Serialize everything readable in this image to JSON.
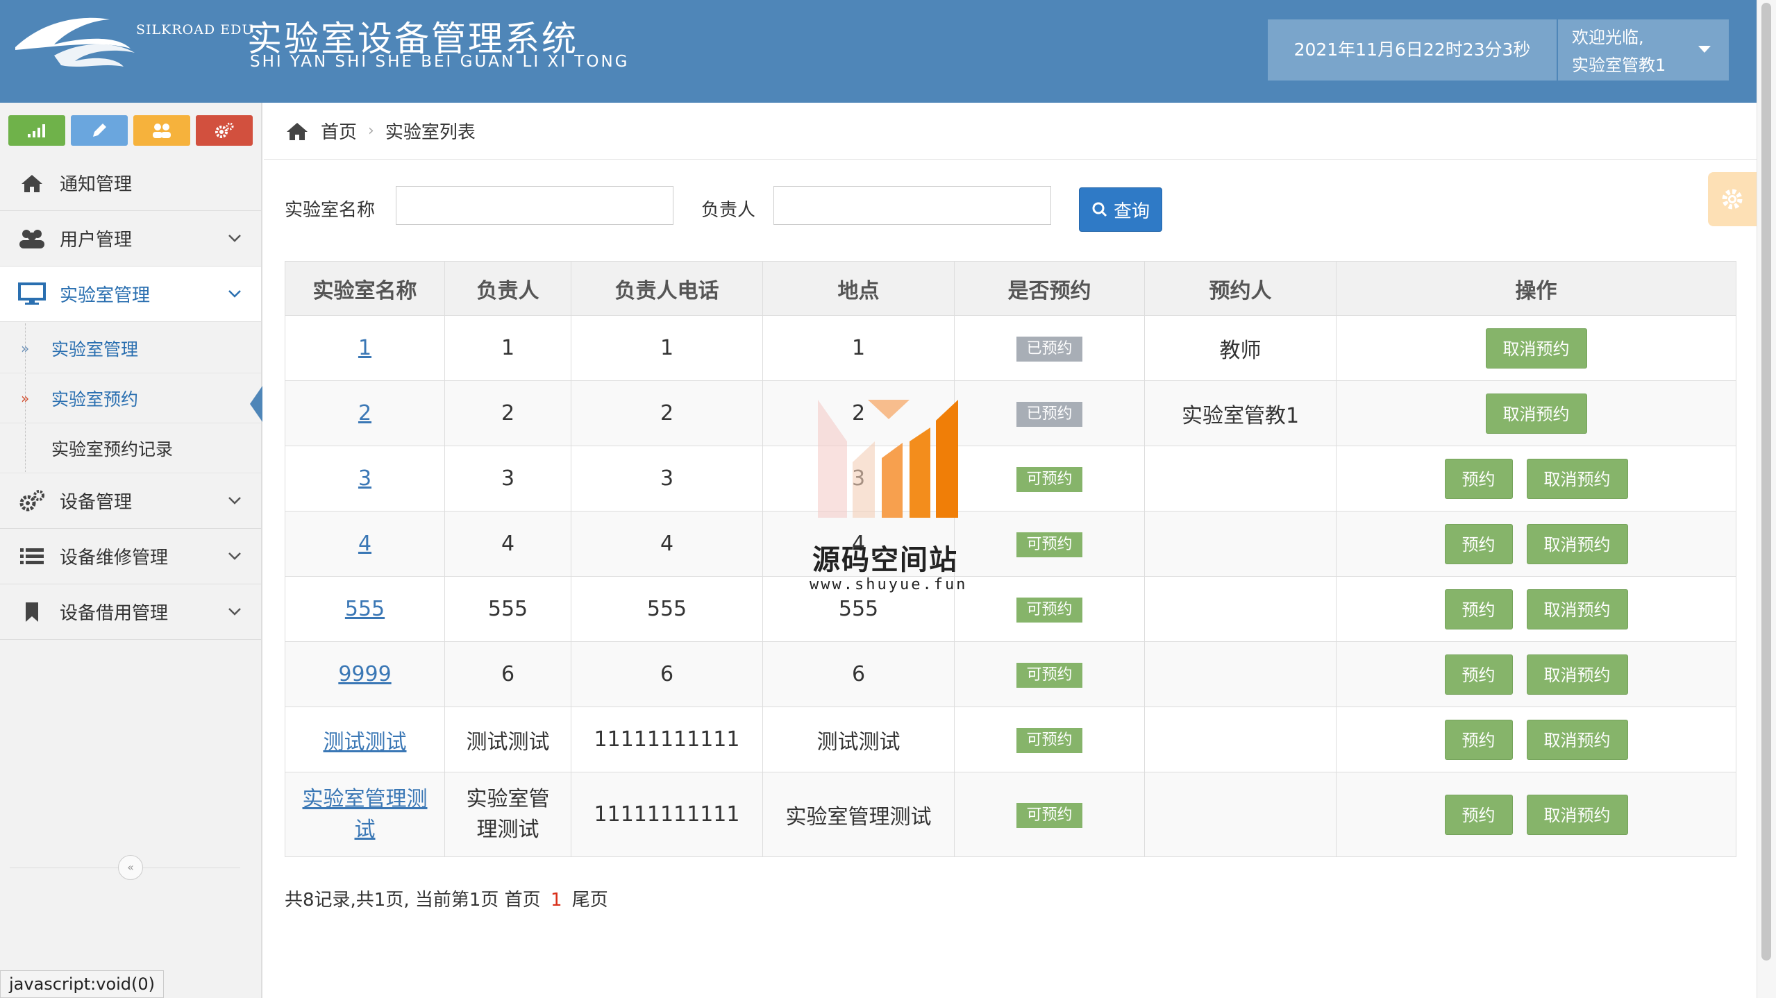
{
  "header": {
    "logo_text": "SILKROAD EDU",
    "title": "实验室设备管理系统",
    "subtitle": "SHI YAN SHI SHE BEI GUAN LI XI TONG",
    "datetime": "2021年11月6日22时23分3秒",
    "welcome": "欢迎光临,",
    "username": "实验室管教1"
  },
  "colors": {
    "header_bg": "#4f86b8",
    "shortcut_green": "#6fb24a",
    "shortcut_blue": "#6aa6de",
    "shortcut_orange": "#f6b23c",
    "shortcut_red": "#d2503e",
    "badge_booked": "#a8aeb6",
    "badge_available": "#86b46a"
  },
  "shortcuts": [
    {
      "icon": "signal-icon"
    },
    {
      "icon": "pencil-icon"
    },
    {
      "icon": "users-icon"
    },
    {
      "icon": "cogs-icon"
    }
  ],
  "sidebar": {
    "items": [
      {
        "label": "通知管理",
        "icon": "home-icon"
      },
      {
        "label": "用户管理",
        "icon": "users-icon"
      },
      {
        "label": "实验室管理",
        "icon": "desktop-icon"
      },
      {
        "label": "设备管理",
        "icon": "cogs-icon"
      },
      {
        "label": "设备维修管理",
        "icon": "list-icon"
      },
      {
        "label": "设备借用管理",
        "icon": "bookmark-icon"
      }
    ],
    "subitems": [
      {
        "label": "实验室管理"
      },
      {
        "label": "实验室预约"
      },
      {
        "label": "实验室预约记录"
      }
    ],
    "collapse_symbol": "«"
  },
  "breadcrumb": {
    "home": "首页",
    "separator": "›",
    "current": "实验室列表"
  },
  "search": {
    "name_label": "实验室名称",
    "name_value": "",
    "owner_label": "负责人",
    "owner_value": "",
    "button_label": "查询"
  },
  "table": {
    "headers": [
      "实验室名称",
      "负责人",
      "负责人电话",
      "地点",
      "是否预约",
      "预约人",
      "操作"
    ],
    "rows": [
      {
        "name": "1",
        "owner": "1",
        "phone": "1",
        "location": "1",
        "status": "已预约",
        "reserver": "教师"
      },
      {
        "name": "2",
        "owner": "2",
        "phone": "2",
        "location": "2",
        "status": "已预约",
        "reserver": "实验室管教1"
      },
      {
        "name": "3",
        "owner": "3",
        "phone": "3",
        "location": "3",
        "status": "可预约",
        "reserver": ""
      },
      {
        "name": "4",
        "owner": "4",
        "phone": "4",
        "location": "4",
        "status": "可预约",
        "reserver": ""
      },
      {
        "name": "555",
        "owner": "555",
        "phone": "555",
        "location": "555",
        "status": "可预约",
        "reserver": ""
      },
      {
        "name": "9999",
        "owner": "6",
        "phone": "6",
        "location": "6",
        "status": "可预约",
        "reserver": ""
      },
      {
        "name": "测试测试",
        "owner": "测试测试",
        "phone": "11111111111",
        "location": "测试测试",
        "status": "可预约",
        "reserver": ""
      },
      {
        "name": "实验室管理测试",
        "owner": "实验室管理测试",
        "phone": "11111111111",
        "location": "实验室管理测试",
        "status": "可预约",
        "reserver": ""
      }
    ],
    "reserve_label": "预约",
    "cancel_label": "取消预约"
  },
  "pager": {
    "summary": "共8记录,共1页, 当前第1页 首页",
    "current_page": "1",
    "last": "尾页"
  },
  "watermark": {
    "title": "源码空间站",
    "url": "www.shuyue.fun"
  },
  "status_bar": "javascript:void(0)"
}
